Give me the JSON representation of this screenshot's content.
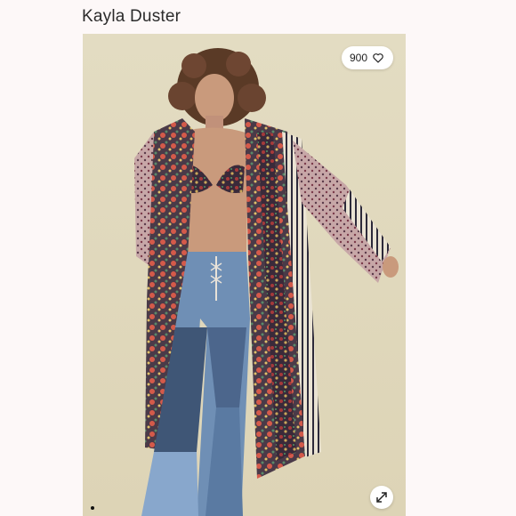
{
  "product": {
    "title": "Kayla Duster"
  },
  "likes": {
    "count": "900",
    "icon": "heart-icon"
  },
  "controls": {
    "expand_icon": "expand-icon"
  },
  "colors": {
    "background": "#fdf8f8",
    "photo_backdrop": "#e2d9bd",
    "denim": "#6f8fb5"
  }
}
